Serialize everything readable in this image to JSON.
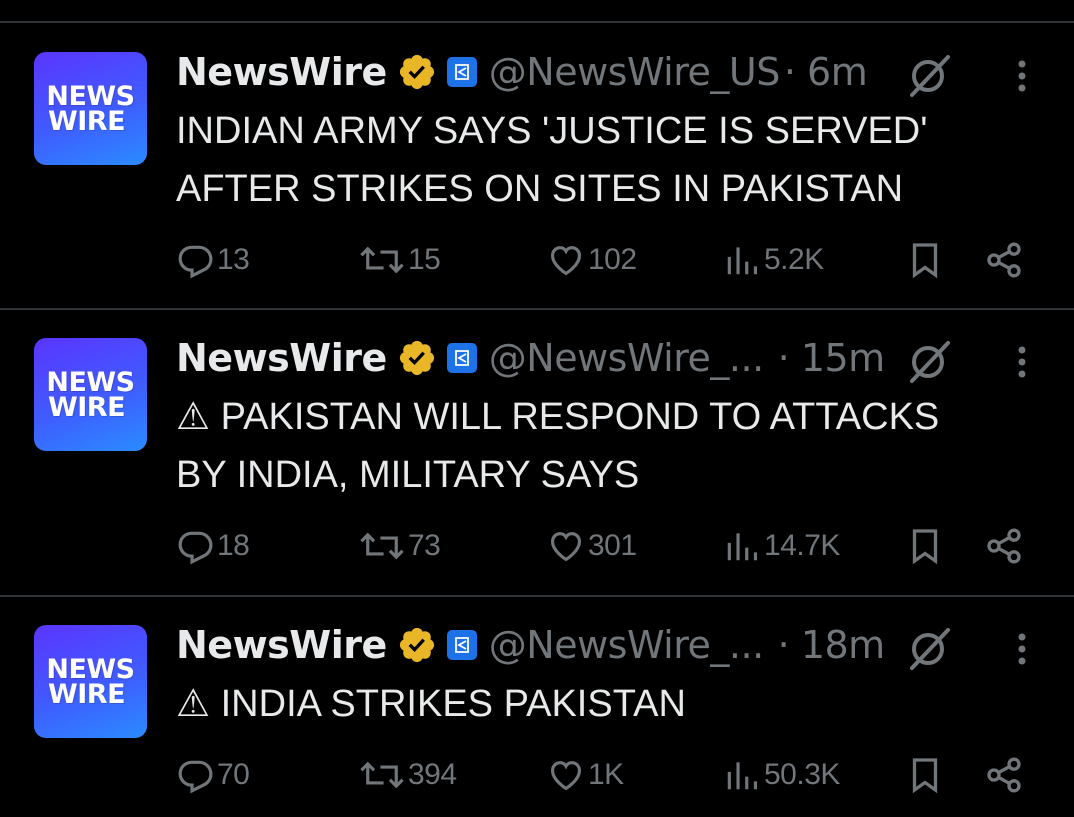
{
  "colors": {
    "background": "#000000",
    "text_primary": "#e7e9ea",
    "text_secondary": "#71767b",
    "divider": "#2f3336",
    "verified_gold": "#e8b627",
    "affiliate_blue": "#1d72e8"
  },
  "avatar_text": {
    "line1": "NEWS",
    "line2": "WIRE"
  },
  "tweets": [
    {
      "name": "NewsWire",
      "handle": "@NewsWire_US",
      "time": "· 6m",
      "text_line1": "INDIAN ARMY SAYS 'JUSTICE IS SERVED'",
      "text_line2": "AFTER STRIKES ON SITES IN PAKISTAN",
      "replies": "13",
      "retweets": "15",
      "likes": "102",
      "views": "5.2K"
    },
    {
      "name": "NewsWire",
      "handle": "@NewsWire_...",
      "time": "· 15m",
      "text_line1": "⚠ PAKISTAN WILL RESPOND TO ATTACKS",
      "text_line2": "BY INDIA, MILITARY SAYS",
      "replies": "18",
      "retweets": "73",
      "likes": "301",
      "views": "14.7K"
    },
    {
      "name": "NewsWire",
      "handle": "@NewsWire_...",
      "time": "· 18m",
      "text_line1": "⚠ INDIA STRIKES PAKISTAN",
      "text_line2": "",
      "replies": "70",
      "retweets": "394",
      "likes": "1K",
      "views": "50.3K"
    }
  ],
  "icons": [
    "verified-badge-icon",
    "affiliate-badge-icon",
    "grok-icon",
    "more-icon",
    "reply-icon",
    "retweet-icon",
    "like-icon",
    "views-icon",
    "bookmark-icon",
    "share-icon"
  ]
}
